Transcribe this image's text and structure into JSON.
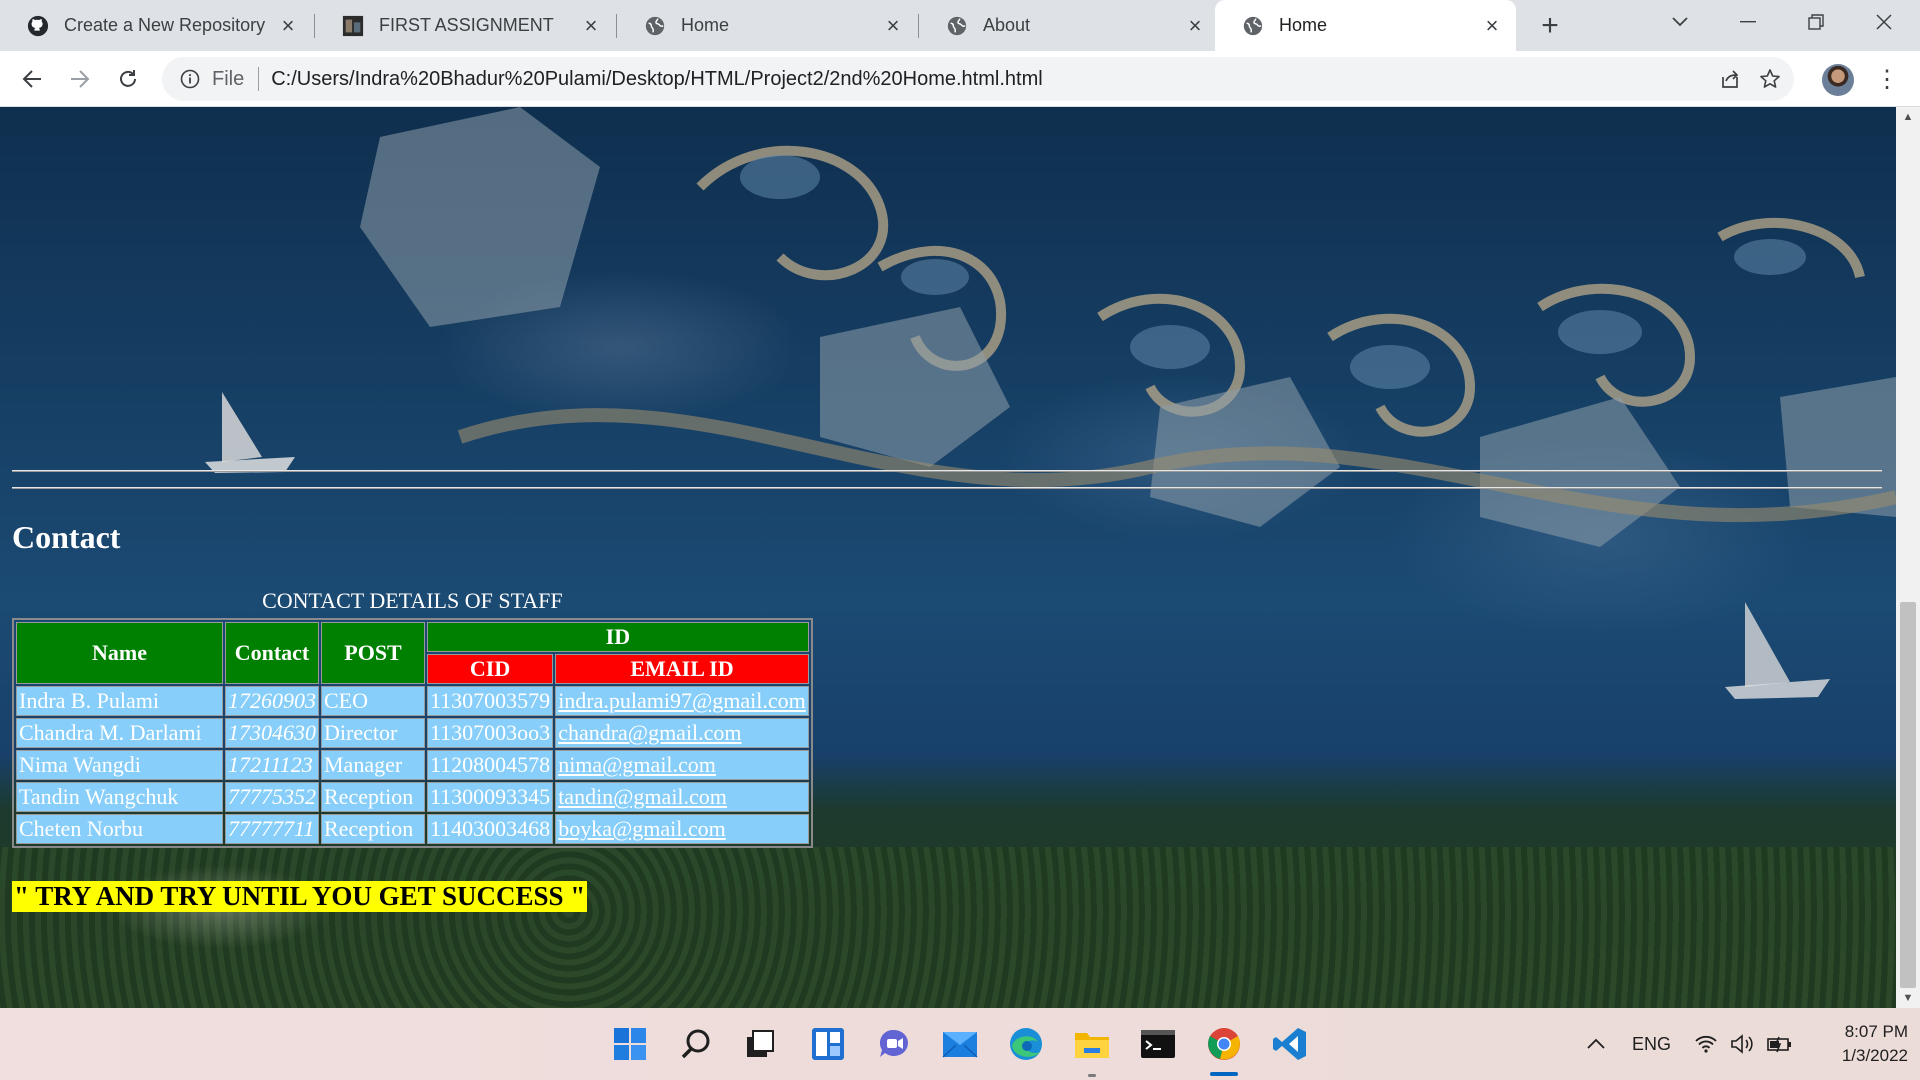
{
  "browser": {
    "tabs": [
      {
        "label": "Create a New Repository",
        "icon": "github-icon"
      },
      {
        "label": "FIRST ASSIGNMENT",
        "icon": "image-favicon-icon"
      },
      {
        "label": "Home",
        "icon": "globe-icon"
      },
      {
        "label": "About",
        "icon": "globe-icon"
      },
      {
        "label": "Home",
        "icon": "globe-icon",
        "active": true
      }
    ],
    "address": {
      "scheme_label": "File",
      "url": "C:/Users/Indra%20Bhadur%20Pulami/Desktop/HTML/Project2/2nd%20Home.html.html"
    }
  },
  "page": {
    "contact_heading": "Contact",
    "table": {
      "caption": "CONTACT DETAILS OF STAFF",
      "headers": {
        "name": "Name",
        "contact": "Contact",
        "post": "POST",
        "id": "ID",
        "cid": "CID",
        "email": "EMAIL ID"
      },
      "rows": [
        {
          "name": "Indra B. Pulami",
          "contact": "17260903",
          "post": "CEO",
          "cid": "11307003579",
          "email": "indra.pulami97@gmail.com"
        },
        {
          "name": "Chandra M. Darlami",
          "contact": "17304630",
          "post": "Director",
          "cid": "11307003oo3",
          "email": "chandra@gmail.com"
        },
        {
          "name": "Nima Wangdi",
          "contact": "17211123",
          "post": "Manager",
          "cid": "11208004578",
          "email": "nima@gmail.com"
        },
        {
          "name": "Tandin Wangchuk",
          "contact": "77775352",
          "post": "Reception",
          "cid": "11300093345",
          "email": "tandin@gmail.com"
        },
        {
          "name": "Cheten Norbu",
          "contact": "77777711",
          "post": "Reception",
          "cid": "11403003468",
          "email": "boyka@gmail.com"
        }
      ]
    },
    "motto": "\" TRY AND TRY UNTIL YOU GET SUCCESS \""
  },
  "taskbar": {
    "apps": [
      "windows-start-icon",
      "search-icon",
      "task-view-icon",
      "widgets-icon",
      "teams-chat-icon",
      "mail-icon",
      "edge-icon",
      "file-explorer-icon",
      "terminal-icon",
      "chrome-icon",
      "vscode-icon"
    ],
    "language": "ENG",
    "time": "8:07 PM",
    "date": "1/3/2022"
  },
  "colors": {
    "header_green": "#008000",
    "header_red": "#ff0000",
    "cell_blue": "#87cefa",
    "motto_yellow": "#ffff00"
  }
}
